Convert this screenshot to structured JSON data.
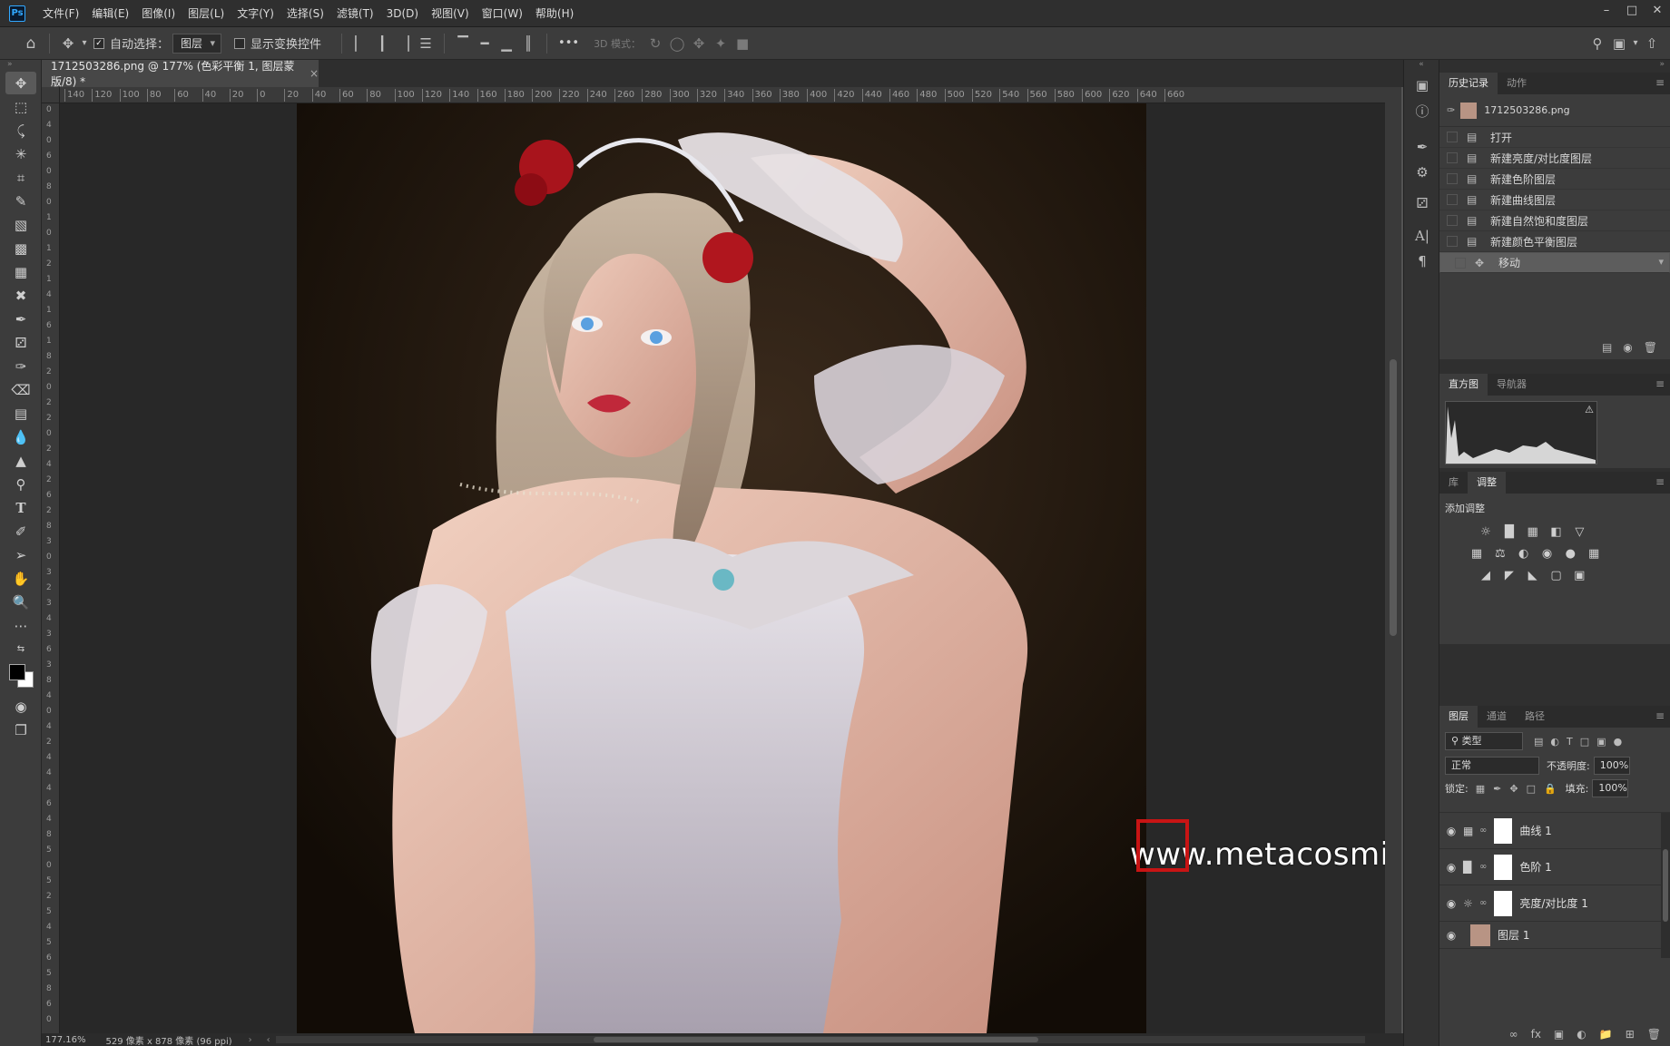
{
  "app": {
    "logo": "Ps"
  },
  "menu": [
    "文件(F)",
    "编辑(E)",
    "图像(I)",
    "图层(L)",
    "文字(Y)",
    "选择(S)",
    "滤镜(T)",
    "3D(D)",
    "视图(V)",
    "窗口(W)",
    "帮助(H)"
  ],
  "options": {
    "auto_select_label": "自动选择：",
    "auto_select_value": "图层",
    "show_transform_label": "显示变换控件",
    "mode_3d_label": "3D 模式：",
    "more": "•••"
  },
  "document": {
    "tab_title": "1712503286.png @ 177% (色彩平衡 1, 图层蒙版/8) *",
    "close": "×",
    "zoom": "177.16%",
    "info": "529 像素 x 878 像素 (96 ppi)"
  },
  "ruler": {
    "h_ticks": [
      "140",
      "120",
      "100",
      "80",
      "60",
      "40",
      "20",
      "0",
      "20",
      "40",
      "60",
      "80",
      "100",
      "120",
      "140",
      "160",
      "180",
      "200",
      "220",
      "240",
      "260",
      "280",
      "300",
      "320",
      "340",
      "360",
      "380",
      "400",
      "420",
      "440",
      "460",
      "480",
      "500",
      "520",
      "540",
      "560",
      "580",
      "600",
      "620",
      "640",
      "660"
    ],
    "v_ticks": [
      "0",
      "4",
      "0",
      "6",
      "0",
      "8",
      "0",
      "1",
      "0",
      "1",
      "2",
      "1",
      "4",
      "1",
      "6",
      "1",
      "8",
      "2",
      "0",
      "2",
      "2",
      "0",
      "2",
      "4",
      "2",
      "6",
      "2",
      "8",
      "3",
      "0",
      "3",
      "2",
      "3",
      "4",
      "3",
      "6",
      "3",
      "8",
      "4",
      "0",
      "4",
      "2",
      "4",
      "4",
      "4",
      "6",
      "4",
      "8",
      "5",
      "0",
      "5",
      "2",
      "5",
      "4",
      "5",
      "6",
      "5",
      "8",
      "6",
      "0"
    ]
  },
  "history": {
    "tabs": [
      "历史记录",
      "动作"
    ],
    "snapshot": "1712503286.png",
    "steps": [
      "打开",
      "新建亮度/对比度图层",
      "新建色阶图层",
      "新建曲线图层",
      "新建自然饱和度图层",
      "新建颜色平衡图层",
      "移动"
    ]
  },
  "histogram": {
    "tabs": [
      "直方图",
      "导航器"
    ],
    "warning": "⚠"
  },
  "adjustments": {
    "tabs": [
      "库",
      "调整"
    ],
    "title": "添加调整"
  },
  "layers": {
    "tabs": [
      "图层",
      "通道",
      "路径"
    ],
    "filter_label": "类型",
    "blend_mode": "正常",
    "opacity_label": "不透明度:",
    "opacity": "100%",
    "lock_label": "锁定:",
    "fill_label": "填充:",
    "fill": "100%",
    "items": [
      {
        "name": "曲线 1",
        "icon": "curves-icon"
      },
      {
        "name": "色阶 1",
        "icon": "levels-icon"
      },
      {
        "name": "亮度/对比度 1",
        "icon": "brightness-icon"
      },
      {
        "name": "图层 1",
        "icon": "image-thumbnail"
      }
    ]
  },
  "watermark": "www.metacosmic.cc"
}
